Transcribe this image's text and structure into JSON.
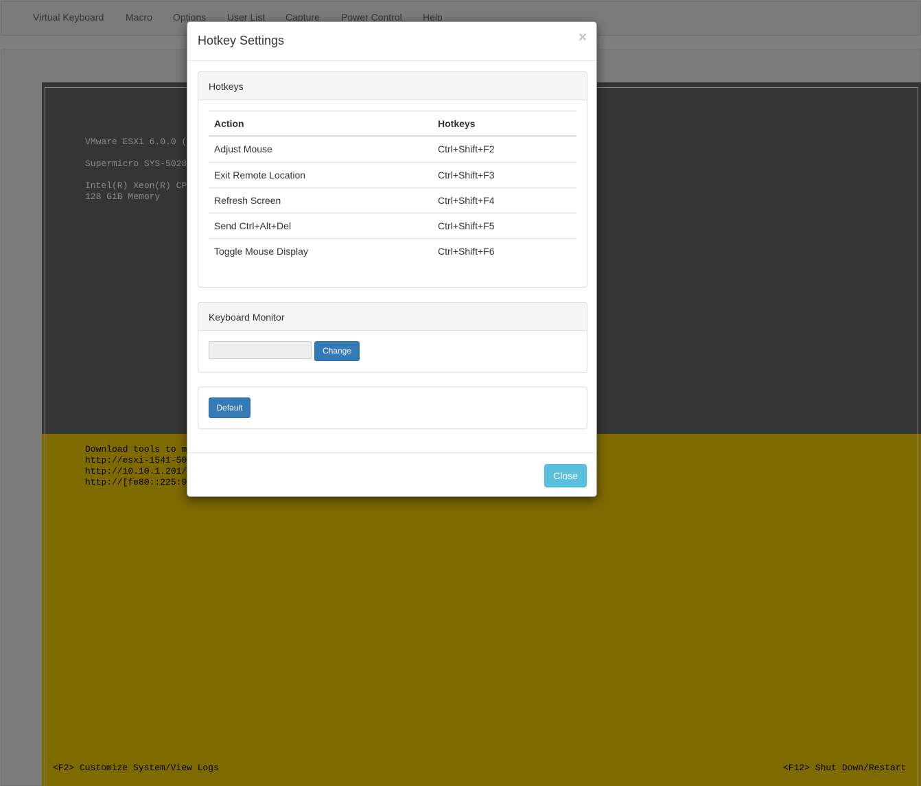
{
  "menubar": {
    "items": [
      "Virtual Keyboard",
      "Macro",
      "Options",
      "User List",
      "Capture",
      "Power Control",
      "Help"
    ]
  },
  "console": {
    "top_lines": [
      "VMware ESXi 6.0.0 (",
      "Supermicro SYS-5028",
      "Intel(R) Xeon(R) CP",
      "128 GiB Memory"
    ],
    "bottom_lines": [
      "Download tools to m",
      "http://esxi-1541-50",
      "http://10.10.1.201/",
      "http://[fe80::225:9"
    ],
    "footer_left": "<F2> Customize System/View Logs",
    "footer_right": "<F12> Shut Down/Restart"
  },
  "modal": {
    "title": "Hotkey Settings",
    "close_symbol": "×",
    "hotkeys_panel": {
      "heading": "Hotkeys",
      "columns": [
        "Action",
        "Hotkeys"
      ],
      "rows": [
        {
          "action": "Adjust Mouse",
          "hotkey": "Ctrl+Shift+F2"
        },
        {
          "action": "Exit Remote Location",
          "hotkey": "Ctrl+Shift+F3"
        },
        {
          "action": "Refresh Screen",
          "hotkey": "Ctrl+Shift+F4"
        },
        {
          "action": "Send Ctrl+Alt+Del",
          "hotkey": "Ctrl+Shift+F5"
        },
        {
          "action": "Toggle Mouse Display",
          "hotkey": "Ctrl+Shift+F6"
        }
      ]
    },
    "keyboard_monitor_panel": {
      "heading": "Keyboard Monitor",
      "input_value": "",
      "change_label": "Change"
    },
    "default_label": "Default",
    "close_label": "Close"
  }
}
